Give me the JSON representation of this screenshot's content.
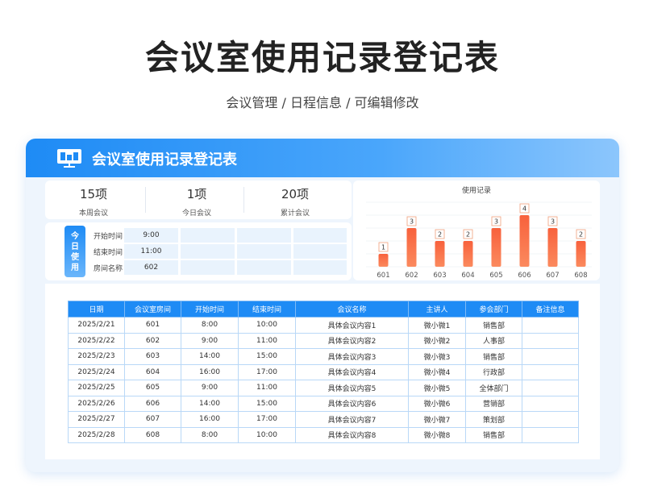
{
  "page": {
    "title": "会议室使用记录登记表",
    "subtitle": "会议管理 / 日程信息 /  可编辑修改"
  },
  "card": {
    "title": "会议室使用记录登记表"
  },
  "stats": [
    {
      "value": "15项",
      "label": "本周会议"
    },
    {
      "value": "1项",
      "label": "今日会议"
    },
    {
      "value": "20项",
      "label": "累计会议"
    }
  ],
  "today": {
    "badge": [
      "今",
      "日",
      "使",
      "用"
    ],
    "rows": [
      {
        "label": "开始时间",
        "value": "9:00"
      },
      {
        "label": "结束时间",
        "value": "11:00"
      },
      {
        "label": "房间名称",
        "value": "602"
      }
    ]
  },
  "chart_data": {
    "type": "bar",
    "title": "使用记录",
    "categories": [
      "601",
      "602",
      "603",
      "604",
      "605",
      "606",
      "607",
      "608"
    ],
    "values": [
      1,
      3,
      2,
      2,
      3,
      4,
      3,
      2
    ],
    "ylim": [
      0,
      5
    ],
    "grid": true,
    "colors": {
      "bar_top": "#f8613c",
      "bar_bottom": "#fb8a5e",
      "label_border": "#f0a07a"
    }
  },
  "table": {
    "headers": [
      "日期",
      "会议室房间",
      "开始时间",
      "结束时间",
      "会议名称",
      "主讲人",
      "参会部门",
      "备注信息"
    ],
    "rows": [
      [
        "2025/2/21",
        "601",
        "8:00",
        "10:00",
        "具体会议内容1",
        "微小微1",
        "销售部",
        ""
      ],
      [
        "2025/2/22",
        "602",
        "9:00",
        "11:00",
        "具体会议内容2",
        "微小微2",
        "人事部",
        ""
      ],
      [
        "2025/2/23",
        "603",
        "14:00",
        "15:00",
        "具体会议内容3",
        "微小微3",
        "销售部",
        ""
      ],
      [
        "2025/2/24",
        "604",
        "16:00",
        "17:00",
        "具体会议内容4",
        "微小微4",
        "行政部",
        ""
      ],
      [
        "2025/2/25",
        "605",
        "9:00",
        "11:00",
        "具体会议内容5",
        "微小微5",
        "全体部门",
        ""
      ],
      [
        "2025/2/26",
        "606",
        "14:00",
        "15:00",
        "具体会议内容6",
        "微小微6",
        "营销部",
        ""
      ],
      [
        "2025/2/27",
        "607",
        "16:00",
        "17:00",
        "具体会议内容7",
        "微小微7",
        "策划部",
        ""
      ],
      [
        "2025/2/28",
        "608",
        "8:00",
        "10:00",
        "具体会议内容8",
        "微小微8",
        "销售部",
        ""
      ]
    ]
  },
  "colors": {
    "accent": "#1e8bf5",
    "header_gradient_end": "#8cc6fc",
    "panel_bg": "#eef5fd",
    "cell_bg": "#e9f3fd"
  }
}
